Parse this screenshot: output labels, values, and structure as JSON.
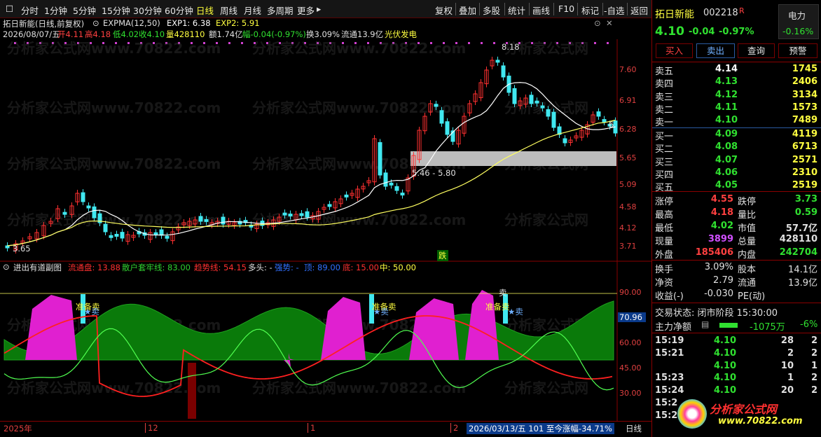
{
  "toolbar": {
    "periods": [
      "分时",
      "1分钟",
      "5分钟",
      "15分钟",
      "30分钟",
      "60分钟",
      "日线",
      "周线",
      "月线",
      "多周期",
      "更多"
    ],
    "active": "日线",
    "tools": [
      "复权",
      "叠加",
      "多股",
      "统计",
      "画线",
      "F10",
      "标记",
      "-自选",
      "返回"
    ]
  },
  "chart_header": {
    "title": "拓日新能(日线,前复权)",
    "expma_label": "EXPMA(12,50)",
    "exp1": "EXP1: 6.38",
    "exp2": "EXP2: 5.91",
    "date": "2026/08/07/五",
    "open": "开4.11",
    "high": "高4.18",
    "low": "低4.02",
    "close": "收4.10",
    "volume": "量428110",
    "amount": "额1.74亿",
    "change": "幅-0.04(-0.97%)",
    "turnover": "换3.09%",
    "float_cap": "流通13.9亿",
    "concept": "光伏发电"
  },
  "main_chart": {
    "y_ticks": [
      "7.60",
      "6.91",
      "6.28",
      "5.65",
      "5.09",
      "4.58",
      "4.12",
      "3.71"
    ],
    "high_label": "8.18",
    "low_label": "3.65",
    "zone_label": "5.46 - 5.80",
    "last_label": "6.",
    "die_label": "跌",
    "watermark": "分析家公式网www.70822.com"
  },
  "indicator": {
    "name": "进出有道副图",
    "items": [
      {
        "label": "流通盘: 13.88",
        "color": "#ff3030"
      },
      {
        "label": "散户套牢线: 83.00",
        "color": "#30d030"
      },
      {
        "label": "趋势线: 54.15",
        "color": "#ff3030"
      },
      {
        "label": "多头: -",
        "color": "#e0e0e0"
      },
      {
        "label": "强势: -",
        "color": "#3070ff"
      },
      {
        "label": "顶: 89.00",
        "color": "#3070ff"
      },
      {
        "label": "底: 15.00",
        "color": "#ff3030"
      },
      {
        "label": "中: 50.00",
        "color": "#ffff40"
      }
    ],
    "y_ticks": [
      "90.00",
      "60.00",
      "45.00",
      "30.00"
    ],
    "current_value": "70.96",
    "signal_prepare_sell": "准备卖",
    "signal_sell": "卖"
  },
  "bottom": {
    "labels": [
      "2025年",
      "12",
      "1",
      "2"
    ],
    "info": "2026/03/13/五 101 至今涨幅-34.71%",
    "period": "日线"
  },
  "quote": {
    "name": "拓日新能",
    "code": "002218",
    "r_tag": "R",
    "sector": "电力",
    "sector_change": "-0.16%",
    "price": "4.10",
    "change": "-0.04",
    "change_pct": "-0.97%",
    "buttons": [
      "买入",
      "卖出",
      "查询",
      "预警"
    ],
    "asks": [
      {
        "label": "卖五",
        "price": "4.14",
        "vol": "1745"
      },
      {
        "label": "卖四",
        "price": "4.13",
        "vol": "2406"
      },
      {
        "label": "卖三",
        "price": "4.12",
        "vol": "3134"
      },
      {
        "label": "卖二",
        "price": "4.11",
        "vol": "1573"
      },
      {
        "label": "卖一",
        "price": "4.10",
        "vol": "7489"
      }
    ],
    "bids": [
      {
        "label": "买一",
        "price": "4.09",
        "vol": "4119"
      },
      {
        "label": "买二",
        "price": "4.08",
        "vol": "6713"
      },
      {
        "label": "买三",
        "price": "4.07",
        "vol": "2571"
      },
      {
        "label": "买四",
        "price": "4.06",
        "vol": "2310"
      },
      {
        "label": "买五",
        "price": "4.05",
        "vol": "2519"
      }
    ],
    "stats": [
      {
        "l1": "涨停",
        "v1": "4.55",
        "c1": "#ff4040",
        "l2": "跌停",
        "v2": "3.73",
        "c2": "#30e030"
      },
      {
        "l1": "最高",
        "v1": "4.18",
        "c1": "#ff4040",
        "l2": "量比",
        "v2": "0.59",
        "c2": "#30e030"
      },
      {
        "l1": "最低",
        "v1": "4.02",
        "c1": "#30e030",
        "l2": "市值",
        "v2": "57.7亿",
        "c2": "#e0e0e0"
      },
      {
        "l1": "现量",
        "v1": "3899",
        "c1": "#d050ff",
        "l2": "总量",
        "v2": "428110",
        "c2": "#e0e0e0"
      },
      {
        "l1": "外盘",
        "v1": "185406",
        "c1": "#ff4040",
        "l2": "内盘",
        "v2": "242704",
        "c2": "#30e030"
      }
    ],
    "stats2": [
      {
        "l1": "换手",
        "v1": "3.09%",
        "l2": "股本",
        "v2": "14.1亿"
      },
      {
        "l1": "净资",
        "v1": "2.79",
        "l2": "流通",
        "v2": "13.9亿"
      },
      {
        "l1": "收益(-)",
        "v1": "-0.030",
        "l2": "PE(动)",
        "v2": ""
      }
    ],
    "trade_status": "交易状态: 闭市阶段 15:30:00",
    "main_flow_label": "主力净额",
    "main_flow_value": "-1075万",
    "main_flow_pct": "-6%",
    "ticks": [
      {
        "time": "15:19",
        "price": "4.10",
        "vol": "28",
        "flag": "2"
      },
      {
        "time": "15:21",
        "price": "4.10",
        "vol": "2",
        "flag": "2"
      },
      {
        "time": "",
        "price": "4.10",
        "vol": "10",
        "flag": "1"
      },
      {
        "time": "15:23",
        "price": "4.10",
        "vol": "1",
        "flag": "2"
      },
      {
        "time": "15:24",
        "price": "4.10",
        "vol": "20",
        "flag": "2"
      },
      {
        "time": "15:2",
        "price": "",
        "vol": "",
        "flag": ""
      },
      {
        "time": "15:2",
        "price": "",
        "vol": "",
        "flag": ""
      }
    ],
    "logo_text": "分析家公式网",
    "logo_url": "www.70822.com"
  }
}
